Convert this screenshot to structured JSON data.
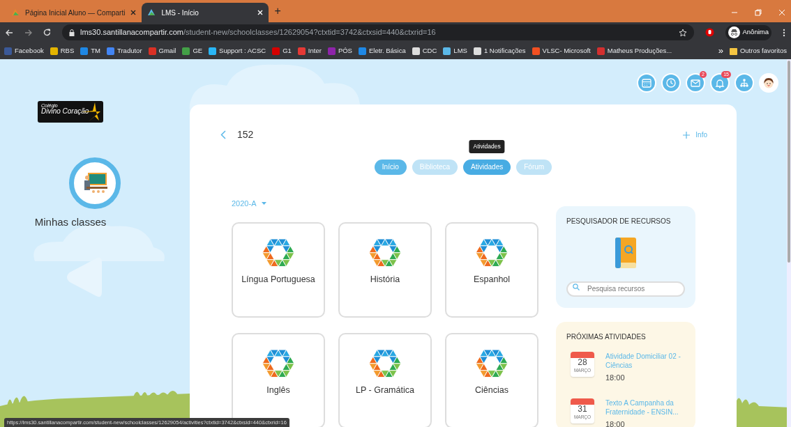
{
  "browser": {
    "tabs": [
      {
        "title": "Página Inicial Aluno — Comparti",
        "selected": false
      },
      {
        "title": "LMS - Início",
        "selected": true
      }
    ],
    "new_tab": "+",
    "address": {
      "domain": "lms30.santillanacompartir.com",
      "path": "/student-new/schoolclasses/12629054?ctxtid=3742&ctxsid=440&ctxrid=16"
    },
    "profile": "Anônima",
    "bookmarks": [
      {
        "label": "Facebook"
      },
      {
        "label": "RBS"
      },
      {
        "label": "TM"
      },
      {
        "label": "Tradutor"
      },
      {
        "label": "Gmail"
      },
      {
        "label": "GE"
      },
      {
        "label": "Support : ACSC"
      },
      {
        "label": "G1"
      },
      {
        "label": "Inter"
      },
      {
        "label": "PÓS"
      },
      {
        "label": "Eletr. Básica"
      },
      {
        "label": "CDC"
      },
      {
        "label": "LMS"
      },
      {
        "label": "1 Notificações"
      },
      {
        "label": "VLSC- Microsoft"
      },
      {
        "label": "Matheus Produções..."
      }
    ],
    "bookmarks_overflow": "»",
    "other_bookmarks": "Outros favoritos"
  },
  "sidebar": {
    "logo": {
      "small": "Colégio",
      "name": "Divino Coração"
    },
    "item": "Minhas classes"
  },
  "header_icons": [
    {
      "kind": "calendar"
    },
    {
      "kind": "clock"
    },
    {
      "kind": "mail",
      "badge": "2"
    },
    {
      "kind": "bell",
      "badge": "15"
    },
    {
      "kind": "hierarchy"
    },
    {
      "kind": "avatar"
    }
  ],
  "course": {
    "title": "152",
    "info": "Info",
    "tabs": [
      {
        "label": "Início",
        "selected": false,
        "disabled": false
      },
      {
        "label": "Biblioteca",
        "selected": false,
        "disabled": true
      },
      {
        "label": "Atividades",
        "selected": true,
        "disabled": false
      },
      {
        "label": "Fórum",
        "selected": false,
        "disabled": true
      }
    ],
    "tooltip": "Atividades",
    "term": "2020-A",
    "subjects": [
      {
        "name": "Língua Portuguesa"
      },
      {
        "name": "História"
      },
      {
        "name": "Espanhol"
      },
      {
        "name": "Inglês"
      },
      {
        "name": "LP - Gramática"
      },
      {
        "name": "Ciências"
      }
    ],
    "resources": {
      "title": "PESQUISADOR DE RECURSOS",
      "placeholder": "Pesquisa recursos"
    },
    "upcoming": {
      "title": "PRÓXIMAS ATIVIDADES",
      "items": [
        {
          "title": "Atividade Domiciliar 02 -Ciências",
          "day": "28",
          "month": "MARÇO",
          "time": "18:00"
        },
        {
          "title": "Texto A Campanha da Fraternidade - ENSIN...",
          "day": "31",
          "month": "MARÇO",
          "time": "18:00"
        }
      ]
    }
  },
  "status_url": "https://lms30.santillanacompartir.com/student-new/schoolclasses/12629054/activities?ctxtid=3742&ctxsid=440&ctxrid=16"
}
